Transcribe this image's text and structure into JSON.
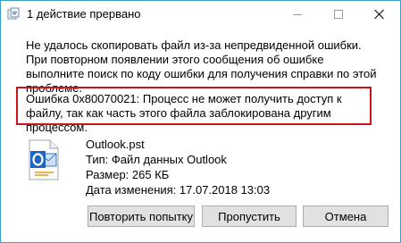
{
  "window": {
    "title": "1 действие прервано",
    "accent_color": "#3aa0c8"
  },
  "message": "Не удалось скопировать файл из-за непредвиденной ошибки. При повторном появлении этого сообщения об ошибке выполните поиск по коду ошибки для получения справки по этой проблеме.",
  "error": {
    "text": "Ошибка 0x80070021: Процесс не может получить доступ к файлу, так как часть этого файла заблокирована другим процессом.",
    "highlight_color": "#d0121c"
  },
  "file": {
    "icon": "outlook-pst-file-icon",
    "name": "Outlook.pst",
    "type": "Тип: Файл данных Outlook",
    "size": "Размер: 265 КБ",
    "modified": "Дата изменения: 17.07.2018 13:03"
  },
  "buttons": {
    "retry": "Повторить попытку",
    "skip": "Пропустить",
    "cancel": "Отмена"
  }
}
